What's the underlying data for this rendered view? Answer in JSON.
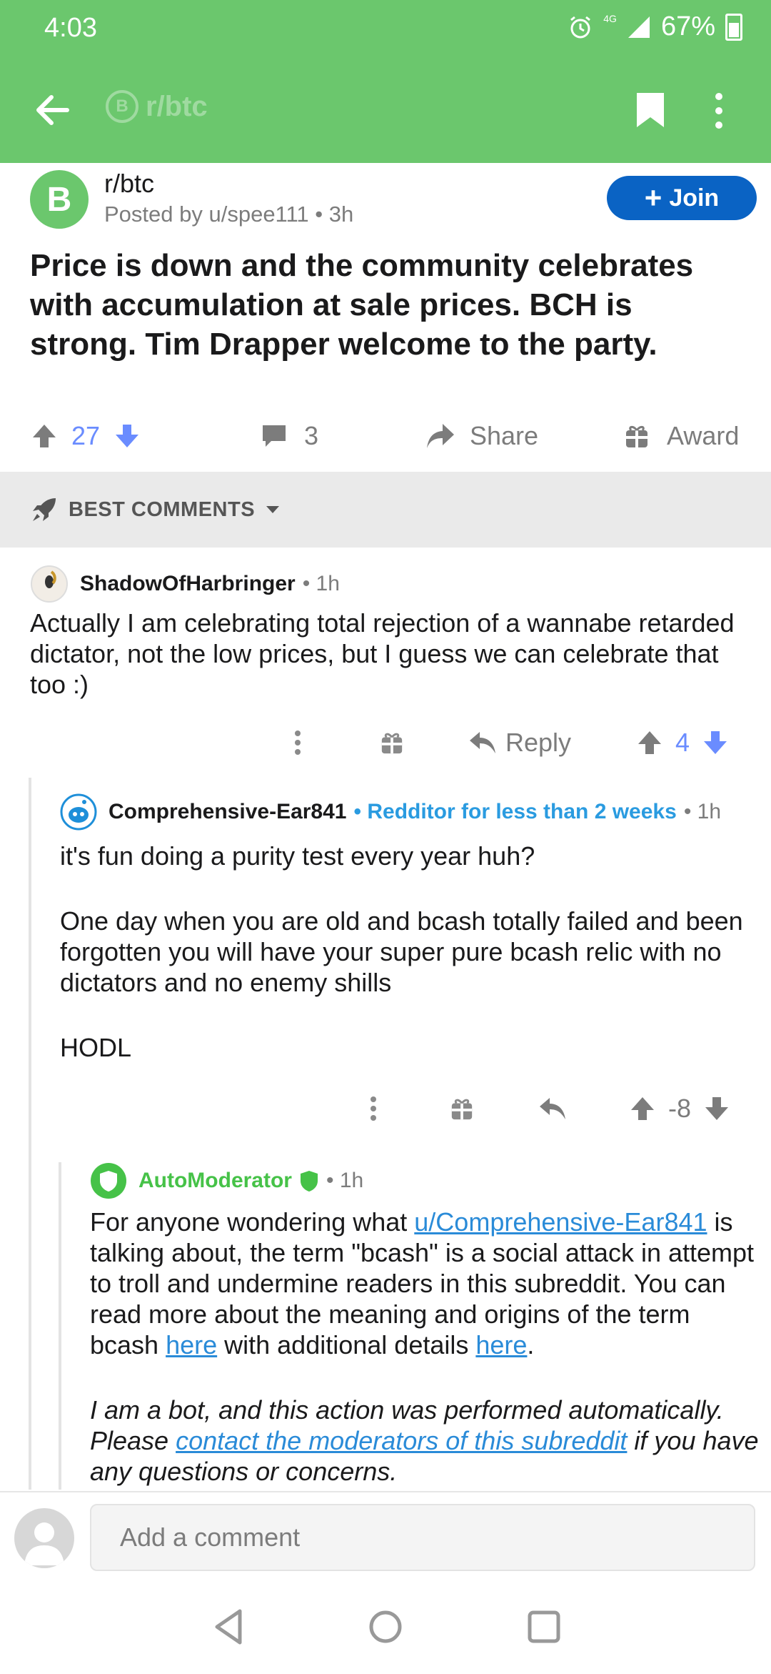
{
  "status_bar": {
    "time": "4:03",
    "network": "4G",
    "battery": "67%"
  },
  "app_bar": {
    "subreddit": "r/btc",
    "coin_symbol": "B"
  },
  "post": {
    "subreddit": "r/btc",
    "avatar_symbol": "B",
    "posted_by": "Posted by u/spee111 • 3h",
    "join_label": "Join",
    "title": "Price is down and the community celebrates with accumulation at sale prices. BCH is strong. Tim Drapper welcome to the party.",
    "votes": "27",
    "comments_count": "3",
    "share_label": "Share",
    "award_label": "Award"
  },
  "sort": {
    "label": "BEST COMMENTS"
  },
  "comments": [
    {
      "author": "ShadowOfHarbringer",
      "time": "• 1h",
      "body": "Actually I am celebrating total rejection of a wannabe retarded dictator, not the low prices, but I guess we can celebrate that too :)",
      "reply_label": "Reply",
      "votes": "4"
    },
    {
      "author": "Comprehensive-Ear841",
      "flair": "• Redditor for less than 2 weeks",
      "time": "• 1h",
      "body_p1": "it's fun doing a purity test every year huh?",
      "body_p2": "One day when you are old and bcash totally failed and been forgotten you will have your super pure bcash relic with no dictators and no enemy shills",
      "body_p3": "HODL",
      "votes": "-8"
    },
    {
      "author": "AutoModerator",
      "time": "• 1h",
      "p1_a": "For anyone wondering what ",
      "p1_link": "u/Comprehensive-Ear841",
      "p1_b": " is talking about, the term \"bcash\" is a social attack in attempt to troll and undermine readers in this subreddit. You can read more about the meaning and origins of the term bcash ",
      "link_here_1": "here",
      "p1_c": " with additional details ",
      "link_here_2": "here",
      "p1_d": ".",
      "p2_a": "I am a bot, and this action was performed automatically. Please ",
      "p2_link": "contact the moderators of this subreddit",
      "p2_b": " if you have any questions or concerns."
    }
  ],
  "composer": {
    "placeholder": "Add a comment"
  },
  "colors": {
    "header_green": "#6bc76d",
    "join_blue": "#0a63c4",
    "upvote_blue": "#6a8cff",
    "link_blue": "#2a8bd8",
    "mod_green": "#46c248"
  }
}
